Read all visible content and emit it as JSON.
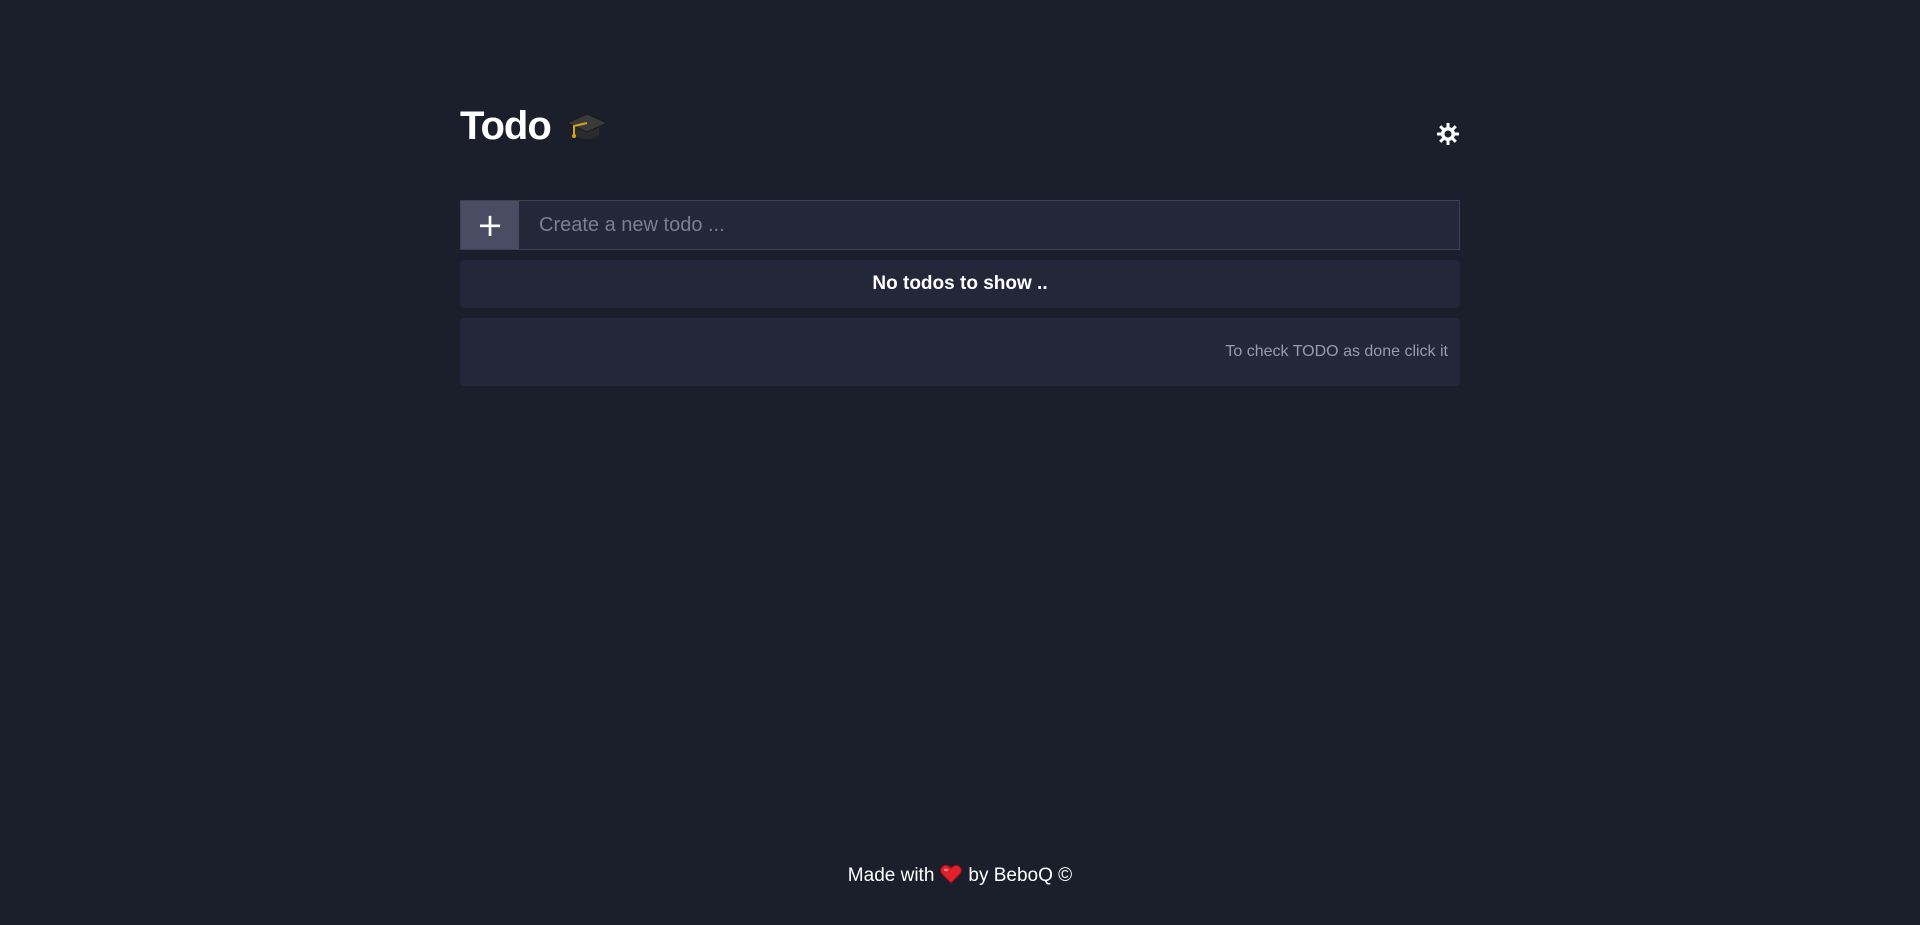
{
  "header": {
    "title": "Todo",
    "title_icon": "graduation-cap-icon",
    "theme_toggle_icon": "sun-icon"
  },
  "new_todo": {
    "add_label": "+",
    "placeholder": "Create a new todo ..."
  },
  "list": {
    "empty_message": "No todos to show .."
  },
  "hint": {
    "text": "To check TODO as done click it"
  },
  "footer": {
    "made_with": "Made with",
    "heart_icon": "heart-icon",
    "by_text": "by BeboQ ©"
  },
  "colors": {
    "background": "#1b1f2c",
    "panel": "#242639",
    "add_button": "#4a4c63",
    "heart": "#e0202c"
  }
}
